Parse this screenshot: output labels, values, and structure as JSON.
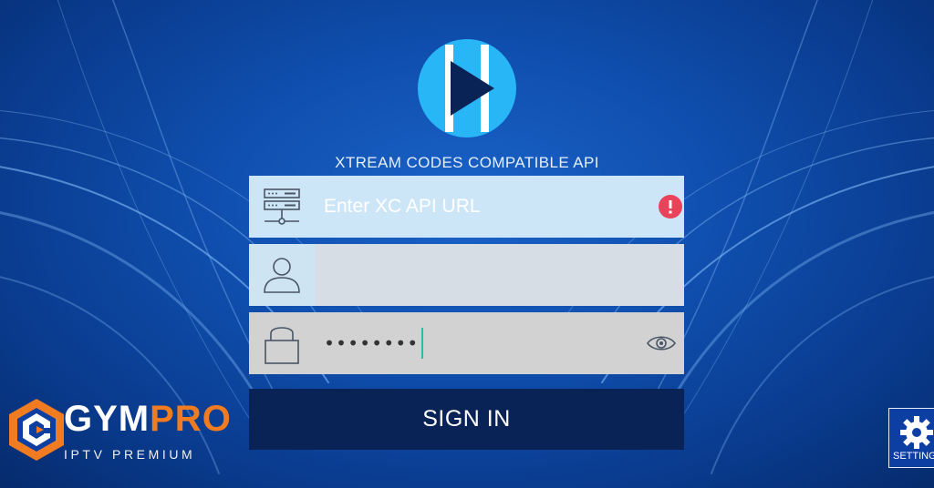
{
  "header": {
    "api_title": "XTREAM CODES COMPATIBLE API"
  },
  "form": {
    "url_placeholder": "Enter XC API URL",
    "username_value": "",
    "password_masked": "••••••••",
    "signin_label": "SIGN IN"
  },
  "brand": {
    "name_part1": "GYM",
    "name_part2": "PRO",
    "tagline": "IPTV PREMIUM"
  },
  "settings": {
    "label": "SETTINGS"
  },
  "icons": {
    "logo": "play-logo-icon",
    "server": "server-icon",
    "user": "user-icon",
    "lock": "lock-icon",
    "error": "error-icon",
    "eye": "eye-icon",
    "gear": "gear-icon"
  },
  "colors": {
    "accent_cyan": "#29b6f6",
    "error_red": "#e8435a",
    "button_dark": "#0a2356",
    "brand_orange": "#f07b21"
  }
}
